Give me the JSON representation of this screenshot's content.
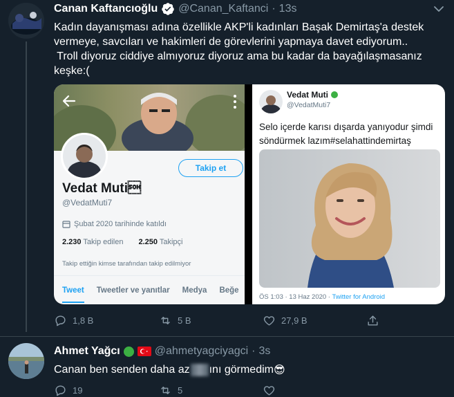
{
  "tweet": {
    "author_name": "Canan Kaftancıoğlu",
    "author_handle": "@Canan_Kaftanci",
    "separator": "·",
    "time": "13s",
    "text_line1": "Kadın dayanışması adına özellikle AKP'li kadınları Başak Demirtaş'a  destek",
    "text_line2": "vermeye, savcıları ve hakimleri de görevlerini yapmaya davet ediyorum..",
    "text_line3": " Troll diyoruz ciddiye almıyoruz diyoruz ama bu kadar da bayağılaşmasanız",
    "text_line4": "keşke:(",
    "actions": {
      "replies": "1,8 B",
      "retweets": "5 B",
      "likes": "27,9 B"
    },
    "colors": {
      "background": "#15202b",
      "secondary_text": "#8899a6",
      "verified": "#ffffff"
    }
  },
  "embedded_profile": {
    "name": "Vedat Muti\u0001",
    "handle": "@VedatMuti7",
    "follow_button": "Takip et",
    "joined": "Şubat 2020 tarihinde katıldı",
    "following_count": "2.230",
    "following_label": "Takip edilen",
    "followers_count": "2.250",
    "followers_label": "Takipçi",
    "followers_note": "Takip ettiğin kimse tarafından takip edilmiyor",
    "tabs": [
      "Tweet",
      "Tweetler ve yanıtlar",
      "Medya",
      "Beğe"
    ]
  },
  "embedded_tweet": {
    "name": "Vedat Muti",
    "handle": "@VedatMuti7",
    "text_line1": "Selo içerde karısı dışarda yanıyodur şimdi",
    "text_line2": "söndürmek lazım#selahattindemirtaş",
    "meta_time": "ÖS 1:03 · 13 Haz 2020 ·",
    "meta_source": "Twitter for Android"
  },
  "reply": {
    "author_name": "Ahmet Yağcı",
    "author_handle": "@ahmetyagciyagci",
    "separator": "·",
    "time": "3s",
    "text_part1": "Canan ben senden daha az",
    "text_part2": "ını görmedim",
    "emoji": "😎",
    "actions": {
      "replies": "19",
      "retweets": "5",
      "likes": ""
    }
  }
}
